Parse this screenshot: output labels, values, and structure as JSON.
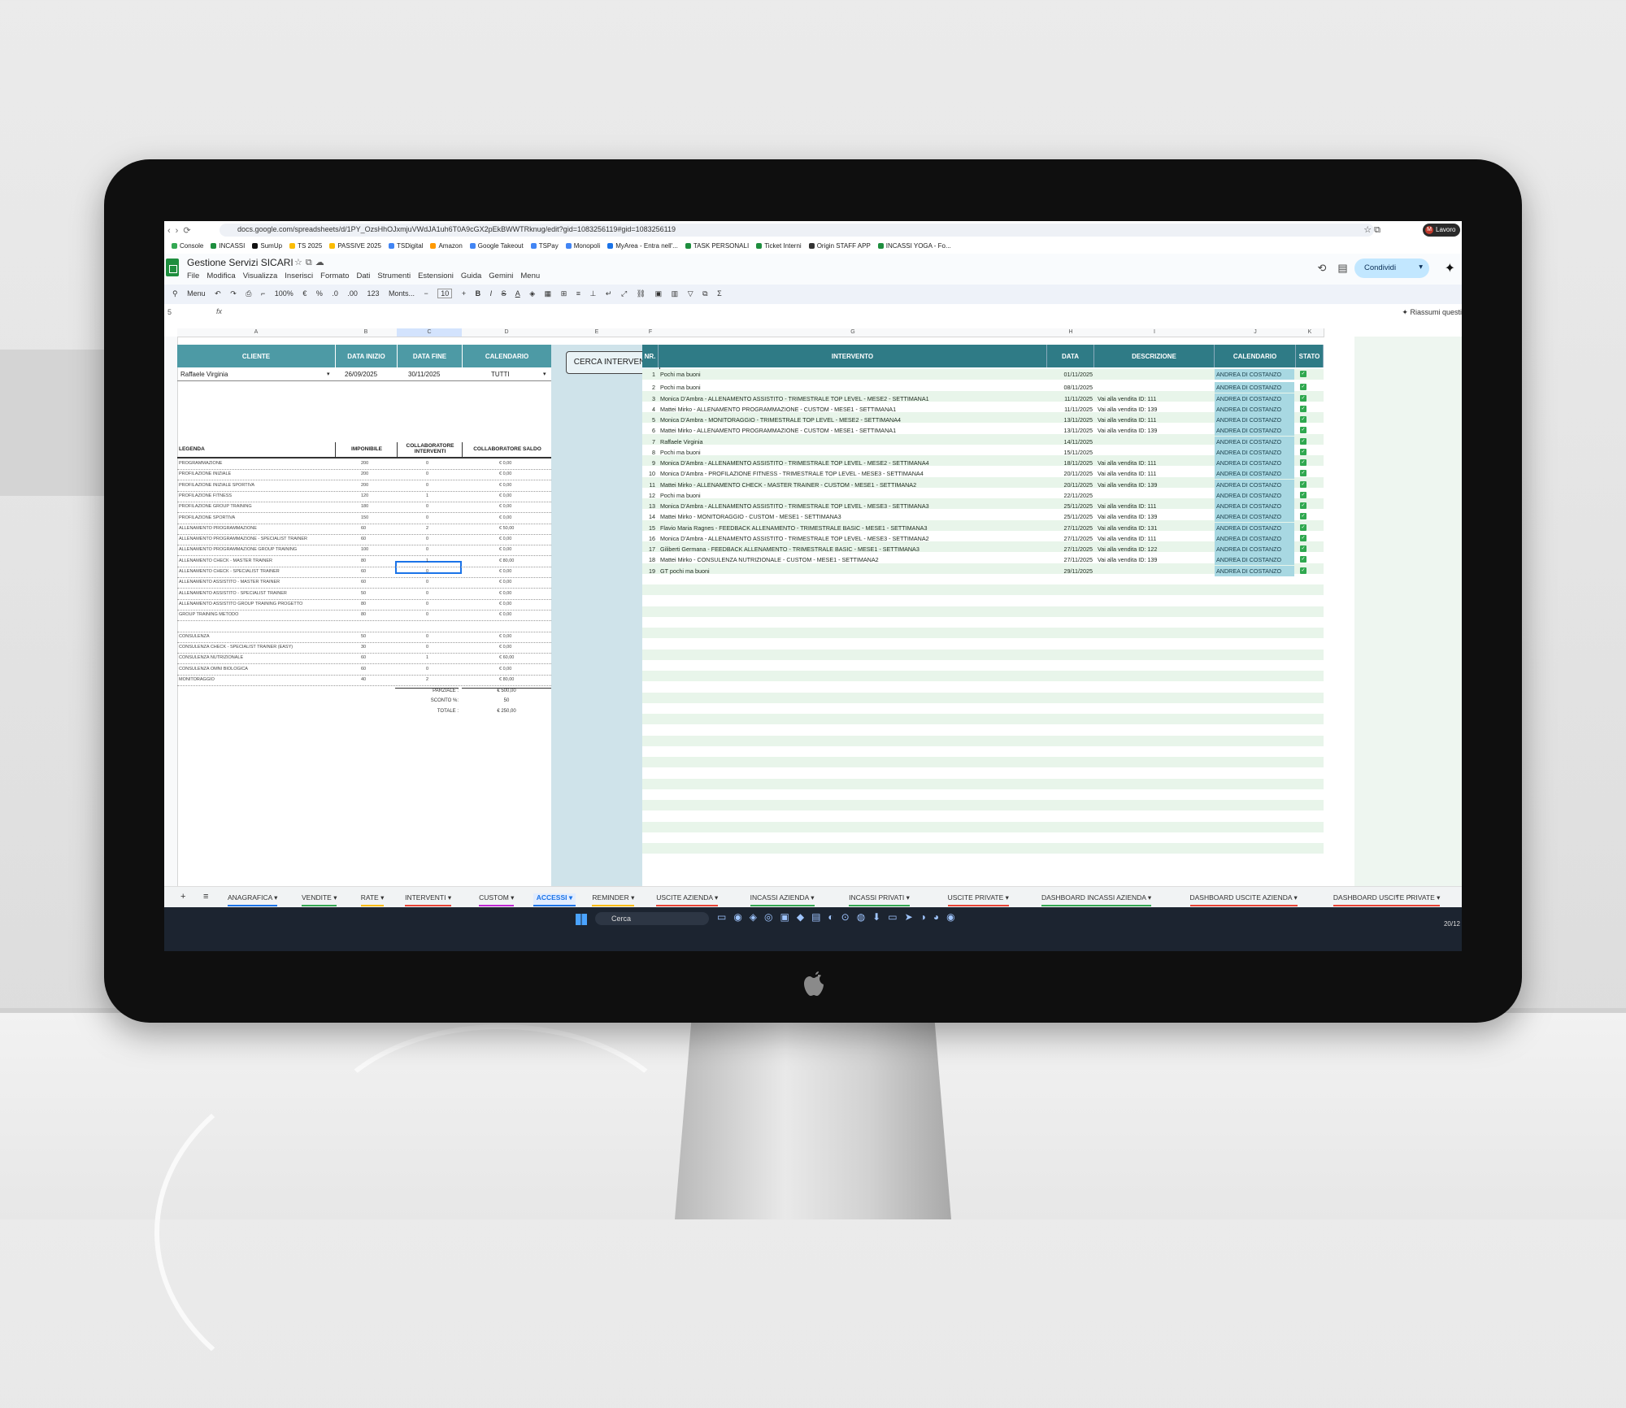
{
  "browser": {
    "url": "docs.google.com/spreadsheets/d/1PY_OzsHhOJxmjuVWdJA1uh6T0A9cGX2pEkBWWTRknug/edit?gid=1083256119#gid=1083256119",
    "profile_label": "Lavoro",
    "profile_initial": "M"
  },
  "bookmarks": [
    {
      "label": "Console",
      "color": "#34a853"
    },
    {
      "label": "INCASSI",
      "color": "#1e8e3e"
    },
    {
      "label": "SumUp",
      "color": "#111111"
    },
    {
      "label": "TS 2025",
      "color": "#fbbc04"
    },
    {
      "label": "PASSIVE 2025",
      "color": "#fbbc04"
    },
    {
      "label": "TSDigital",
      "color": "#4285f4"
    },
    {
      "label": "Amazon",
      "color": "#ff9900"
    },
    {
      "label": "Google Takeout",
      "color": "#4285f4"
    },
    {
      "label": "TSPay",
      "color": "#4285f4"
    },
    {
      "label": "Monopoli",
      "color": "#4285f4"
    },
    {
      "label": "MyArea - Entra nell'...",
      "color": "#1a73e8"
    },
    {
      "label": "TASK PERSONALI",
      "color": "#1e8e3e"
    },
    {
      "label": "Ticket Interni",
      "color": "#1e8e3e"
    },
    {
      "label": "Origin STAFF APP",
      "color": "#333333"
    },
    {
      "label": "INCASSI YOGA - Fo...",
      "color": "#1e8e3e"
    }
  ],
  "doc": {
    "title": "Gestione Servizi SICARI",
    "menus": [
      "File",
      "Modifica",
      "Visualizza",
      "Inserisci",
      "Formato",
      "Dati",
      "Strumenti",
      "Estensioni",
      "Guida",
      "Gemini",
      "Menu"
    ],
    "share_label": "Condividi"
  },
  "toolbar": {
    "menu_label": "Menu",
    "zoom": "100%",
    "currency": "€",
    "percent": "%",
    "dec_minus": ".0",
    "dec_plus": ".00",
    "number_format": "123",
    "font": "Monts...",
    "font_size": "10"
  },
  "formula_bar": {
    "cell_ref": "5",
    "fx": "fx",
    "summarize": "Riassumi questi"
  },
  "columns": [
    "A",
    "B",
    "C",
    "D",
    "E",
    "F",
    "G",
    "H",
    "I",
    "J",
    "K"
  ],
  "left_headers": {
    "cliente": "CLIENTE",
    "data_inizio": "DATA INIZIO",
    "data_fine": "DATA FINE",
    "calendario": "CALENDARIO"
  },
  "filters": {
    "cliente": "Raffaele Virginia",
    "data_inizio": "26/09/2025",
    "data_fine": "30/11/2025",
    "calendario": "TUTTI"
  },
  "search_button": "CERCA INTERVENTI",
  "legend_headers": {
    "legenda": "LEGENDA",
    "imponibile": "IMPONIBILE",
    "interventi": "COLLABORATORE INTERVENTI",
    "saldo": "COLLABORATORE SALDO"
  },
  "legend_rows": [
    {
      "name": "PROGRAMMAZIONE",
      "imponibile": "200",
      "interventi": "0",
      "saldo": "€ 0,00"
    },
    {
      "name": "PROFILAZIONE INIZIALE",
      "imponibile": "200",
      "interventi": "0",
      "saldo": "€ 0,00"
    },
    {
      "name": "PROFILAZIONE INIZIALE SPORTIVA",
      "imponibile": "200",
      "interventi": "0",
      "saldo": "€ 0,00"
    },
    {
      "name": "PROFILAZIONE FITNESS",
      "imponibile": "120",
      "interventi": "1",
      "saldo": "€ 0,00"
    },
    {
      "name": "PROFILAZIONE GROUP TRAINING",
      "imponibile": "180",
      "interventi": "0",
      "saldo": "€ 0,00"
    },
    {
      "name": "PROFILAZIONE SPORTIVA",
      "imponibile": "150",
      "interventi": "0",
      "saldo": "€ 0,00"
    },
    {
      "name": "ALLENAMENTO PROGRAMMAZIONE",
      "imponibile": "60",
      "interventi": "2",
      "saldo": "€ 50,00"
    },
    {
      "name": "ALLENAMENTO PROGRAMMAZIONE - SPECIALIST TRAINER",
      "imponibile": "60",
      "interventi": "0",
      "saldo": "€ 0,00"
    },
    {
      "name": "ALLENAMENTO PROGRAMMAZIONE GROUP TRAINING",
      "imponibile": "100",
      "interventi": "0",
      "saldo": "€ 0,00"
    },
    {
      "name": "ALLENAMENTO CHECK - MASTER TRAINER",
      "imponibile": "80",
      "interventi": "1",
      "saldo": "€ 80,00"
    },
    {
      "name": "ALLENAMENTO CHECK - SPECIALIST TRAINER",
      "imponibile": "60",
      "interventi": "0",
      "saldo": "€ 0,00"
    },
    {
      "name": "ALLENAMENTO ASSISTITO - MASTER TRAINER",
      "imponibile": "60",
      "interventi": "0",
      "saldo": "€ 0,00"
    },
    {
      "name": "ALLENAMENTO ASSISTITO - SPECIALIST TRAINER",
      "imponibile": "50",
      "interventi": "0",
      "saldo": "€ 0,00"
    },
    {
      "name": "ALLENAMENTO ASSISTITO GROUP TRAINING PROGETTO",
      "imponibile": "80",
      "interventi": "0",
      "saldo": "€ 0,00"
    },
    {
      "name": "GROUP TRAINING METODO",
      "imponibile": "80",
      "interventi": "0",
      "saldo": "€ 0,00"
    },
    {
      "name": "",
      "imponibile": "",
      "interventi": "",
      "saldo": ""
    },
    {
      "name": "CONSULENZA",
      "imponibile": "50",
      "interventi": "0",
      "saldo": "€ 0,00"
    },
    {
      "name": "CONSULENZA CHECK - SPECIALIST TRAINER (EASY)",
      "imponibile": "30",
      "interventi": "0",
      "saldo": "€ 0,00"
    },
    {
      "name": "CONSULENZA NUTRIZIONALE",
      "imponibile": "60",
      "interventi": "1",
      "saldo": "€ 60,00"
    },
    {
      "name": "CONSULENZA OMNI BIOLOGICA",
      "imponibile": "60",
      "interventi": "0",
      "saldo": "€ 0,00"
    },
    {
      "name": "MONITORAGGIO",
      "imponibile": "40",
      "interventi": "2",
      "saldo": "€ 80,00"
    }
  ],
  "totals": [
    {
      "label": "PARZIALE :",
      "value": "€ 500,00"
    },
    {
      "label": "SCONTO %:",
      "value": "50"
    },
    {
      "label": "TOTALE :",
      "value": "€ 250,00"
    }
  ],
  "right_headers": {
    "nr": "NR.",
    "intervento": "INTERVENTO",
    "data": "DATA",
    "descrizione": "DESCRIZIONE",
    "calendario": "CALENDARIO",
    "stato": "STATO"
  },
  "interventions": [
    {
      "nr": "1",
      "intervento": "Pochi ma buoni",
      "data": "01/11/2025",
      "descrizione": "",
      "calendario": "ANDREA DI COSTANZO"
    },
    {
      "nr": "2",
      "intervento": "Pochi ma buoni",
      "data": "08/11/2025",
      "descrizione": "",
      "calendario": "ANDREA DI COSTANZO"
    },
    {
      "nr": "3",
      "intervento": "Monica D'Ambra - ALLENAMENTO ASSISTITO - TRIMESTRALE TOP LEVEL - MESE2 - SETTIMANA1",
      "data": "11/11/2025",
      "descrizione": "Vai alla vendita ID: 111",
      "calendario": "ANDREA DI COSTANZO"
    },
    {
      "nr": "4",
      "intervento": "Mattei Mirko - ALLENAMENTO PROGRAMMAZIONE - CUSTOM - MESE1 - SETTIMANA1",
      "data": "11/11/2025",
      "descrizione": "Vai alla vendita ID: 139",
      "calendario": "ANDREA DI COSTANZO"
    },
    {
      "nr": "5",
      "intervento": "Monica D'Ambra - MONITORAGGIO - TRIMESTRALE TOP LEVEL - MESE2 - SETTIMANA4",
      "data": "13/11/2025",
      "descrizione": "Vai alla vendita ID: 111",
      "calendario": "ANDREA DI COSTANZO"
    },
    {
      "nr": "6",
      "intervento": "Mattei Mirko - ALLENAMENTO PROGRAMMAZIONE - CUSTOM - MESE1 - SETTIMANA1",
      "data": "13/11/2025",
      "descrizione": "Vai alla vendita ID: 139",
      "calendario": "ANDREA DI COSTANZO"
    },
    {
      "nr": "7",
      "intervento": "Raffaele Virginia",
      "data": "14/11/2025",
      "descrizione": "",
      "calendario": "ANDREA DI COSTANZO"
    },
    {
      "nr": "8",
      "intervento": "Pochi ma buoni",
      "data": "15/11/2025",
      "descrizione": "",
      "calendario": "ANDREA DI COSTANZO"
    },
    {
      "nr": "9",
      "intervento": "Monica D'Ambra - ALLENAMENTO ASSISTITO - TRIMESTRALE TOP LEVEL - MESE2 - SETTIMANA4",
      "data": "18/11/2025",
      "descrizione": "Vai alla vendita ID: 111",
      "calendario": "ANDREA DI COSTANZO"
    },
    {
      "nr": "10",
      "intervento": "Monica D'Ambra - PROFILAZIONE FITNESS - TRIMESTRALE TOP LEVEL - MESE3 - SETTIMANA4",
      "data": "20/11/2025",
      "descrizione": "Vai alla vendita ID: 111",
      "calendario": "ANDREA DI COSTANZO"
    },
    {
      "nr": "11",
      "intervento": "Mattei Mirko - ALLENAMENTO CHECK - MASTER TRAINER - CUSTOM - MESE1 - SETTIMANA2",
      "data": "20/11/2025",
      "descrizione": "Vai alla vendita ID: 139",
      "calendario": "ANDREA DI COSTANZO"
    },
    {
      "nr": "12",
      "intervento": "Pochi ma buoni",
      "data": "22/11/2025",
      "descrizione": "",
      "calendario": "ANDREA DI COSTANZO"
    },
    {
      "nr": "13",
      "intervento": "Monica D'Ambra - ALLENAMENTO ASSISTITO - TRIMESTRALE TOP LEVEL - MESE3 - SETTIMANA3",
      "data": "25/11/2025",
      "descrizione": "Vai alla vendita ID: 111",
      "calendario": "ANDREA DI COSTANZO"
    },
    {
      "nr": "14",
      "intervento": "Mattei Mirko - MONITORAGGIO - CUSTOM - MESE1 - SETTIMANA3",
      "data": "25/11/2025",
      "descrizione": "Vai alla vendita ID: 139",
      "calendario": "ANDREA DI COSTANZO"
    },
    {
      "nr": "15",
      "intervento": "Flavio Maria Ragnes - FEEDBACK ALLENAMENTO - TRIMESTRALE BASIC - MESE1 - SETTIMANA3",
      "data": "27/11/2025",
      "descrizione": "Vai alla vendita ID: 131",
      "calendario": "ANDREA DI COSTANZO"
    },
    {
      "nr": "16",
      "intervento": "Monica D'Ambra - ALLENAMENTO ASSISTITO - TRIMESTRALE TOP LEVEL - MESE3 - SETTIMANA2",
      "data": "27/11/2025",
      "descrizione": "Vai alla vendita ID: 111",
      "calendario": "ANDREA DI COSTANZO"
    },
    {
      "nr": "17",
      "intervento": "Giliberti Germana - FEEDBACK ALLENAMENTO - TRIMESTRALE BASIC - MESE1 - SETTIMANA3",
      "data": "27/11/2025",
      "descrizione": "Vai alla vendita ID: 122",
      "calendario": "ANDREA DI COSTANZO"
    },
    {
      "nr": "18",
      "intervento": "Mattei Mirko - CONSULENZA NUTRIZIONALE - CUSTOM - MESE1 - SETTIMANA2",
      "data": "27/11/2025",
      "descrizione": "Vai alla vendita ID: 139",
      "calendario": "ANDREA DI COSTANZO"
    },
    {
      "nr": "19",
      "intervento": "GT pochi ma buoni",
      "data": "29/11/2025",
      "descrizione": "",
      "calendario": "ANDREA DI COSTANZO"
    }
  ],
  "sheet_tabs": [
    {
      "label": "ANAGRAFICA",
      "color": "#1a73e8",
      "active": false
    },
    {
      "label": "VENDITE",
      "color": "#34a853",
      "active": false
    },
    {
      "label": "RATE",
      "color": "#fbbc04",
      "active": false
    },
    {
      "label": "INTERVENTI",
      "color": "#ea4335",
      "active": false
    },
    {
      "label": "CUSTOM",
      "color": "#c026d3",
      "active": false
    },
    {
      "label": "ACCESSI",
      "color": "#1a73e8",
      "active": true
    },
    {
      "label": "REMINDER",
      "color": "#fbbc04",
      "active": false
    },
    {
      "label": "USCITE AZIENDA",
      "color": "#ea4335",
      "active": false
    },
    {
      "label": "INCASSI AZIENDA",
      "color": "#34a853",
      "active": false
    },
    {
      "label": "INCASSI PRIVATI",
      "color": "#34a853",
      "active": false
    },
    {
      "label": "USCITE PRIVATE",
      "color": "#ea4335",
      "active": false
    },
    {
      "label": "DASHBOARD INCASSI AZIENDA",
      "color": "#34a853",
      "active": false
    },
    {
      "label": "DASHBOARD USCITE AZIENDA",
      "color": "#ea4335",
      "active": false
    },
    {
      "label": "DASHBOARD USCITE PRIVATE",
      "color": "#ea4335",
      "active": false
    }
  ],
  "taskbar": {
    "search_label": "Cerca",
    "clock": "20/12"
  },
  "colors": {
    "header_teal": "#2f7b86",
    "row_green": "#e8f5ea",
    "calendar_blue": "#a8d8e2",
    "check_green": "#2fa84f"
  }
}
